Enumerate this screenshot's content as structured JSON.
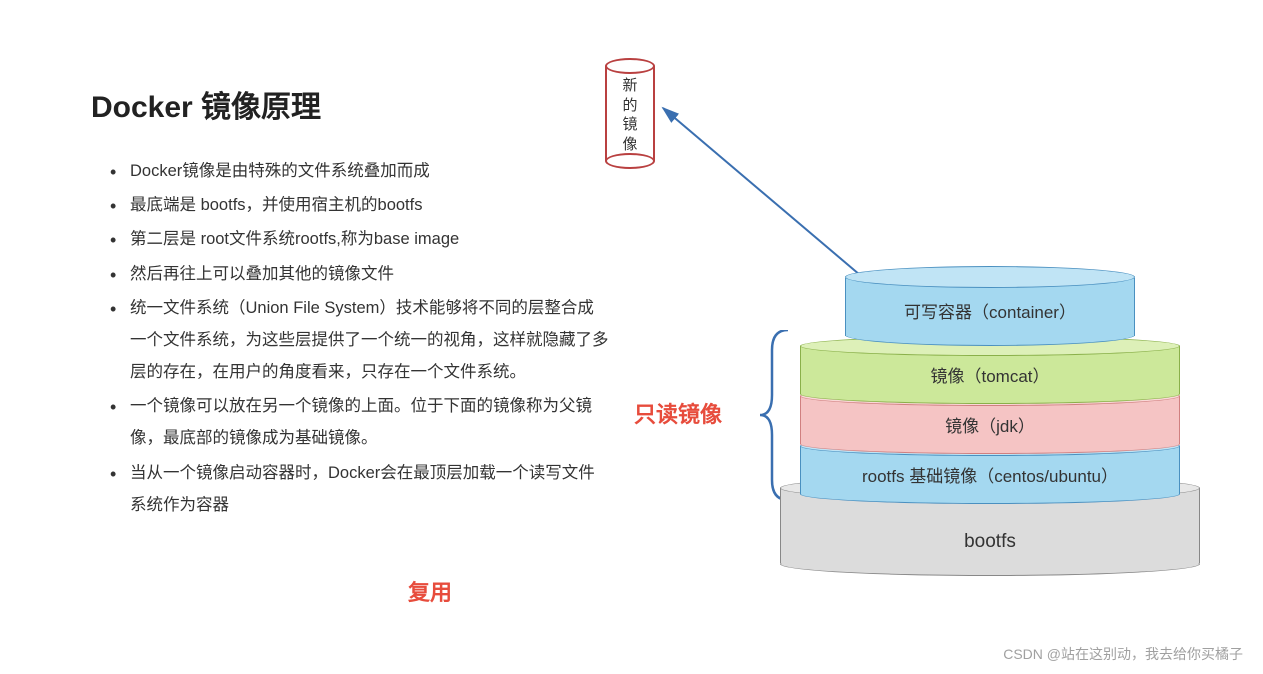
{
  "title": "Docker 镜像原理",
  "bullets": [
    "Docker镜像是由特殊的文件系统叠加而成",
    "最底端是 bootfs，并使用宿主机的bootfs",
    "第二层是 root文件系统rootfs,称为base image",
    "然后再往上可以叠加其他的镜像文件",
    "统一文件系统（Union File System）技术能够将不同的层整合成一个文件系统，为这些层提供了一个统一的视角，这样就隐藏了多层的存在，在用户的角度看来，只存在一个文件系统。",
    "一个镜像可以放在另一个镜像的上面。位于下面的镜像称为父镜像，最底部的镜像成为基础镜像。",
    "当从一个镜像启动容器时，Docker会在最顶层加载一个读写文件系统作为容器"
  ],
  "labels": {
    "reuse": "复用",
    "readonly": "只读镜像",
    "new_image": "新的镜像"
  },
  "layers": {
    "container": "可写容器（container）",
    "tomcat": "镜像（tomcat）",
    "jdk": "镜像（jdk）",
    "rootfs": "rootfs 基础镜像（centos/ubuntu）",
    "bootfs": "bootfs"
  },
  "watermark": "CSDN @站在这别动，我去给你买橘子"
}
